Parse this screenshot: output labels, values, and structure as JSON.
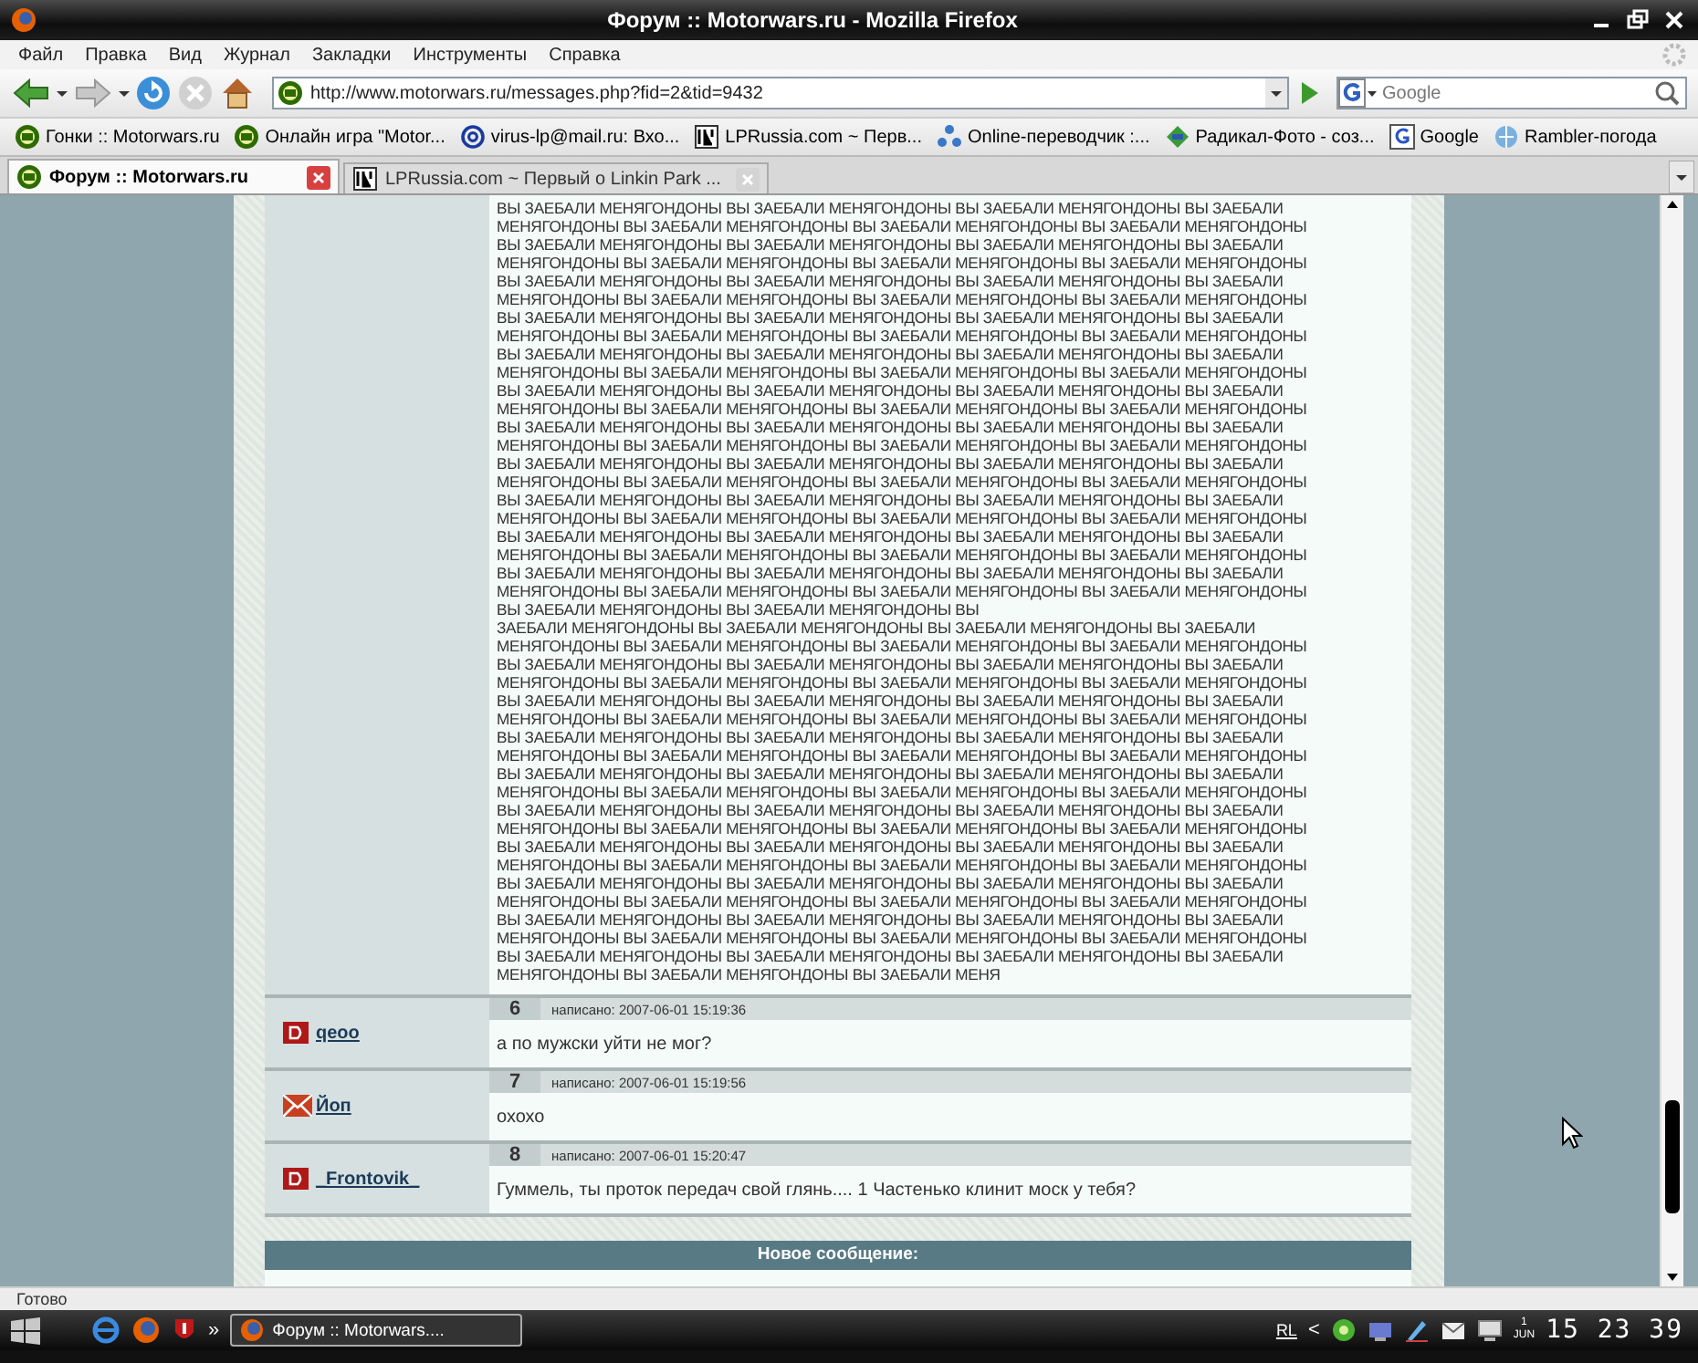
{
  "window": {
    "title": "Форум :: Motorwars.ru - Mozilla Firefox"
  },
  "menu": [
    "Файл",
    "Правка",
    "Вид",
    "Журнал",
    "Закладки",
    "Инструменты",
    "Справка"
  ],
  "address": {
    "url": "http://www.motorwars.ru/messages.php?fid=2&tid=9432"
  },
  "search": {
    "placeholder": "Google"
  },
  "bookmarks": [
    {
      "label": "Гонки :: Motorwars.ru"
    },
    {
      "label": "Онлайн игра \"Motor..."
    },
    {
      "label": "virus-lp@mail.ru: Вхо..."
    },
    {
      "label": "LPRussia.com ~ Перв..."
    },
    {
      "label": "Online-переводчик :..."
    },
    {
      "label": "Радикал-Фото - соз..."
    },
    {
      "label": "Google"
    },
    {
      "label": "Rambler-погода"
    }
  ],
  "tabs": [
    {
      "label": "Форум :: Motorwars.ru",
      "selected": true
    },
    {
      "label": "LPRussia.com ~ Первый о Linkin Park ...",
      "selected": false
    }
  ],
  "first_post": {
    "lines": [
      "ВЫ ЗАЕБАЛИ МЕНЯГОНДОНЫ ВЫ ЗАЕБАЛИ МЕНЯГОНДОНЫ ВЫ ЗАЕБАЛИ МЕНЯГОНДОНЫ ВЫ ЗАЕБАЛИ",
      "МЕНЯГОНДОНЫ ВЫ ЗАЕБАЛИ МЕНЯГОНДОНЫ ВЫ ЗАЕБАЛИ МЕНЯГОНДОНЫ ВЫ ЗАЕБАЛИ МЕНЯГОНДОНЫ",
      "ВЫ ЗАЕБАЛИ МЕНЯГОНДОНЫ ВЫ ЗАЕБАЛИ МЕНЯГОНДОНЫ ВЫ ЗАЕБАЛИ МЕНЯГОНДОНЫ ВЫ ЗАЕБАЛИ",
      "МЕНЯГОНДОНЫ ВЫ ЗАЕБАЛИ МЕНЯГОНДОНЫ ВЫ ЗАЕБАЛИ МЕНЯГОНДОНЫ ВЫ ЗАЕБАЛИ МЕНЯГОНДОНЫ",
      "ВЫ ЗАЕБАЛИ МЕНЯГОНДОНЫ ВЫ ЗАЕБАЛИ МЕНЯГОНДОНЫ ВЫ ЗАЕБАЛИ МЕНЯГОНДОНЫ ВЫ ЗАЕБАЛИ",
      "МЕНЯГОНДОНЫ ВЫ ЗАЕБАЛИ МЕНЯГОНДОНЫ ВЫ ЗАЕБАЛИ МЕНЯГОНДОНЫ ВЫ ЗАЕБАЛИ МЕНЯГОНДОНЫ",
      "ВЫ ЗАЕБАЛИ МЕНЯГОНДОНЫ ВЫ ЗАЕБАЛИ МЕНЯГОНДОНЫ ВЫ ЗАЕБАЛИ МЕНЯГОНДОНЫ ВЫ ЗАЕБАЛИ",
      "МЕНЯГОНДОНЫ ВЫ ЗАЕБАЛИ МЕНЯГОНДОНЫ ВЫ ЗАЕБАЛИ МЕНЯГОНДОНЫ ВЫ ЗАЕБАЛИ МЕНЯГОНДОНЫ",
      "ВЫ ЗАЕБАЛИ МЕНЯГОНДОНЫ ВЫ ЗАЕБАЛИ МЕНЯГОНДОНЫ ВЫ ЗАЕБАЛИ МЕНЯГОНДОНЫ ВЫ ЗАЕБАЛИ",
      "МЕНЯГОНДОНЫ ВЫ ЗАЕБАЛИ МЕНЯГОНДОНЫ ВЫ ЗАЕБАЛИ МЕНЯГОНДОНЫ ВЫ ЗАЕБАЛИ МЕНЯГОНДОНЫ",
      "ВЫ ЗАЕБАЛИ МЕНЯГОНДОНЫ ВЫ ЗАЕБАЛИ МЕНЯГОНДОНЫ ВЫ ЗАЕБАЛИ МЕНЯГОНДОНЫ ВЫ ЗАЕБАЛИ",
      "МЕНЯГОНДОНЫ ВЫ ЗАЕБАЛИ МЕНЯГОНДОНЫ ВЫ ЗАЕБАЛИ МЕНЯГОНДОНЫ ВЫ ЗАЕБАЛИ МЕНЯГОНДОНЫ",
      "ВЫ ЗАЕБАЛИ МЕНЯГОНДОНЫ ВЫ ЗАЕБАЛИ МЕНЯГОНДОНЫ ВЫ ЗАЕБАЛИ МЕНЯГОНДОНЫ ВЫ ЗАЕБАЛИ",
      "МЕНЯГОНДОНЫ ВЫ ЗАЕБАЛИ МЕНЯГОНДОНЫ ВЫ ЗАЕБАЛИ МЕНЯГОНДОНЫ ВЫ ЗАЕБАЛИ МЕНЯГОНДОНЫ",
      "ВЫ ЗАЕБАЛИ МЕНЯГОНДОНЫ ВЫ ЗАЕБАЛИ МЕНЯГОНДОНЫ ВЫ ЗАЕБАЛИ МЕНЯГОНДОНЫ ВЫ ЗАЕБАЛИ",
      "МЕНЯГОНДОНЫ ВЫ ЗАЕБАЛИ МЕНЯГОНДОНЫ ВЫ ЗАЕБАЛИ МЕНЯГОНДОНЫ ВЫ ЗАЕБАЛИ МЕНЯГОНДОНЫ",
      "ВЫ ЗАЕБАЛИ МЕНЯГОНДОНЫ ВЫ ЗАЕБАЛИ МЕНЯГОНДОНЫ ВЫ ЗАЕБАЛИ МЕНЯГОНДОНЫ ВЫ ЗАЕБАЛИ",
      "МЕНЯГОНДОНЫ ВЫ ЗАЕБАЛИ МЕНЯГОНДОНЫ ВЫ ЗАЕБАЛИ МЕНЯГОНДОНЫ ВЫ ЗАЕБАЛИ МЕНЯГОНДОНЫ",
      "ВЫ ЗАЕБАЛИ МЕНЯГОНДОНЫ ВЫ ЗАЕБАЛИ МЕНЯГОНДОНЫ ВЫ ЗАЕБАЛИ МЕНЯГОНДОНЫ ВЫ ЗАЕБАЛИ",
      "МЕНЯГОНДОНЫ ВЫ ЗАЕБАЛИ МЕНЯГОНДОНЫ ВЫ ЗАЕБАЛИ МЕНЯГОНДОНЫ ВЫ ЗАЕБАЛИ МЕНЯГОНДОНЫ",
      "ВЫ ЗАЕБАЛИ МЕНЯГОНДОНЫ ВЫ ЗАЕБАЛИ МЕНЯГОНДОНЫ ВЫ ЗАЕБАЛИ МЕНЯГОНДОНЫ ВЫ ЗАЕБАЛИ",
      "МЕНЯГОНДОНЫ ВЫ ЗАЕБАЛИ МЕНЯГОНДОНЫ ВЫ ЗАЕБАЛИ МЕНЯГОНДОНЫ ВЫ ЗАЕБАЛИ МЕНЯГОНДОНЫ",
      "ВЫ ЗАЕБАЛИ МЕНЯГОНДОНЫ ВЫ ЗАЕБАЛИ МЕНЯГОНДОНЫ ВЫ",
      "ЗАЕБАЛИ МЕНЯГОНДОНЫ ВЫ ЗАЕБАЛИ МЕНЯГОНДОНЫ ВЫ ЗАЕБАЛИ МЕНЯГОНДОНЫ ВЫ ЗАЕБАЛИ",
      "МЕНЯГОНДОНЫ ВЫ ЗАЕБАЛИ МЕНЯГОНДОНЫ ВЫ ЗАЕБАЛИ МЕНЯГОНДОНЫ ВЫ ЗАЕБАЛИ МЕНЯГОНДОНЫ",
      "ВЫ ЗАЕБАЛИ МЕНЯГОНДОНЫ ВЫ ЗАЕБАЛИ МЕНЯГОНДОНЫ ВЫ ЗАЕБАЛИ МЕНЯГОНДОНЫ ВЫ ЗАЕБАЛИ",
      "МЕНЯГОНДОНЫ ВЫ ЗАЕБАЛИ МЕНЯГОНДОНЫ ВЫ ЗАЕБАЛИ МЕНЯГОНДОНЫ ВЫ ЗАЕБАЛИ МЕНЯГОНДОНЫ",
      "ВЫ ЗАЕБАЛИ МЕНЯГОНДОНЫ ВЫ ЗАЕБАЛИ МЕНЯГОНДОНЫ ВЫ ЗАЕБАЛИ МЕНЯГОНДОНЫ ВЫ ЗАЕБАЛИ",
      "МЕНЯГОНДОНЫ ВЫ ЗАЕБАЛИ МЕНЯГОНДОНЫ ВЫ ЗАЕБАЛИ МЕНЯГОНДОНЫ ВЫ ЗАЕБАЛИ МЕНЯГОНДОНЫ",
      "ВЫ ЗАЕБАЛИ МЕНЯГОНДОНЫ ВЫ ЗАЕБАЛИ МЕНЯГОНДОНЫ ВЫ ЗАЕБАЛИ МЕНЯГОНДОНЫ ВЫ ЗАЕБАЛИ",
      "МЕНЯГОНДОНЫ ВЫ ЗАЕБАЛИ МЕНЯГОНДОНЫ ВЫ ЗАЕБАЛИ МЕНЯГОНДОНЫ ВЫ ЗАЕБАЛИ МЕНЯГОНДОНЫ",
      "ВЫ ЗАЕБАЛИ МЕНЯГОНДОНЫ ВЫ ЗАЕБАЛИ МЕНЯГОНДОНЫ ВЫ ЗАЕБАЛИ МЕНЯГОНДОНЫ ВЫ ЗАЕБАЛИ",
      "МЕНЯГОНДОНЫ ВЫ ЗАЕБАЛИ МЕНЯГОНДОНЫ ВЫ ЗАЕБАЛИ МЕНЯГОНДОНЫ ВЫ ЗАЕБАЛИ МЕНЯГОНДОНЫ",
      "ВЫ ЗАЕБАЛИ МЕНЯГОНДОНЫ ВЫ ЗАЕБАЛИ МЕНЯГОНДОНЫ ВЫ ЗАЕБАЛИ МЕНЯГОНДОНЫ ВЫ ЗАЕБАЛИ",
      "МЕНЯГОНДОНЫ ВЫ ЗАЕБАЛИ МЕНЯГОНДОНЫ ВЫ ЗАЕБАЛИ МЕНЯГОНДОНЫ ВЫ ЗАЕБАЛИ МЕНЯГОНДОНЫ",
      "ВЫ ЗАЕБАЛИ МЕНЯГОНДОНЫ ВЫ ЗАЕБАЛИ МЕНЯГОНДОНЫ ВЫ ЗАЕБАЛИ МЕНЯГОНДОНЫ ВЫ ЗАЕБАЛИ",
      "МЕНЯГОНДОНЫ ВЫ ЗАЕБАЛИ МЕНЯГОНДОНЫ ВЫ ЗАЕБАЛИ МЕНЯГОНДОНЫ ВЫ ЗАЕБАЛИ МЕНЯГОНДОНЫ",
      "ВЫ ЗАЕБАЛИ МЕНЯГОНДОНЫ ВЫ ЗАЕБАЛИ МЕНЯГОНДОНЫ ВЫ ЗАЕБАЛИ МЕНЯГОНДОНЫ ВЫ ЗАЕБАЛИ",
      "МЕНЯГОНДОНЫ ВЫ ЗАЕБАЛИ МЕНЯГОНДОНЫ ВЫ ЗАЕБАЛИ МЕНЯГОНДОНЫ ВЫ ЗАЕБАЛИ МЕНЯГОНДОНЫ",
      "ВЫ ЗАЕБАЛИ МЕНЯГОНДОНЫ ВЫ ЗАЕБАЛИ МЕНЯГОНДОНЫ ВЫ ЗАЕБАЛИ МЕНЯГОНДОНЫ ВЫ ЗАЕБАЛИ",
      "МЕНЯГОНДОНЫ ВЫ ЗАЕБАЛИ МЕНЯГОНДОНЫ ВЫ ЗАЕБАЛИ МЕНЯГОНДОНЫ ВЫ ЗАЕБАЛИ МЕНЯГОНДОНЫ",
      "ВЫ ЗАЕБАЛИ МЕНЯГОНДОНЫ ВЫ ЗАЕБАЛИ МЕНЯГОНДОНЫ ВЫ ЗАЕБАЛИ МЕНЯГОНДОНЫ ВЫ ЗАЕБАЛИ",
      "МЕНЯГОНДОНЫ ВЫ ЗАЕБАЛИ МЕНЯГОНДОНЫ ВЫ ЗАЕБАЛИ МЕНЯ"
    ]
  },
  "posts": [
    {
      "number": "6",
      "author": "qeoo",
      "kind": "badge",
      "posted": "написано: 2007-06-01 15:19:36",
      "text": "а по мужски уйти не мог?"
    },
    {
      "number": "7",
      "author": "Йоп",
      "kind": "envelope",
      "posted": "написано: 2007-06-01 15:19:56",
      "text": "охохо"
    },
    {
      "number": "8",
      "author": "_Frontovik_",
      "kind": "badge",
      "posted": "написано: 2007-06-01 15:20:47",
      "text": "Гуммель, ты проток передач свой глянь.... 1 Частенько клинит моск у тебя?"
    }
  ],
  "new_message": {
    "title": "Новое сообщение:"
  },
  "status_bar": {
    "text": "Готово"
  },
  "taskbar": {
    "more": "»",
    "tasks": [
      {
        "label": "Форум :: Motorwars....",
        "selected": true
      }
    ],
    "language": "RL",
    "tray_arrow": "<",
    "date_day": "1",
    "date_month": "JUN",
    "clock": "15 23 39"
  }
}
